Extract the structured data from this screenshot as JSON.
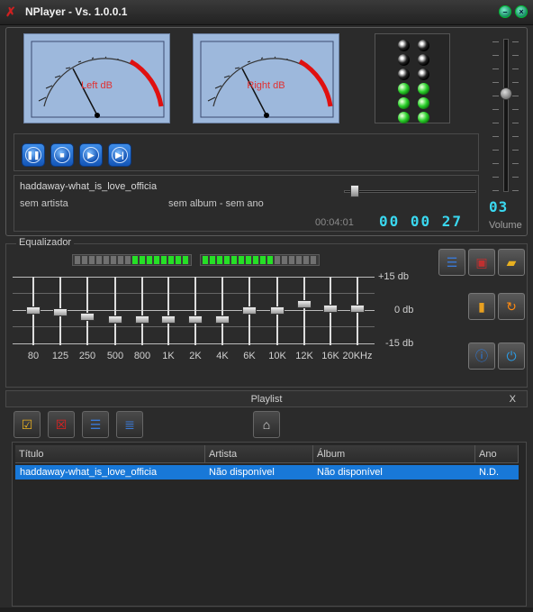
{
  "window": {
    "title": "NPlayer - Vs.  1.0.0.1",
    "minimize_icon": "minimize-icon",
    "close_icon": "close-icon"
  },
  "meters": {
    "left_label": "Left dB",
    "right_label": "Right dB"
  },
  "leds": {
    "left": [
      "off",
      "off",
      "off",
      "on",
      "on",
      "on"
    ],
    "right": [
      "off",
      "off",
      "off",
      "on",
      "on",
      "on"
    ]
  },
  "volume": {
    "digits": "03",
    "label": "Volume",
    "level": 0.64
  },
  "transport": {
    "buttons": [
      {
        "name": "pause-button",
        "icon": "pause-icon"
      },
      {
        "name": "stop-button",
        "icon": "stop-icon"
      },
      {
        "name": "play-button",
        "icon": "play-icon"
      },
      {
        "name": "next-button",
        "icon": "next-track-icon"
      }
    ]
  },
  "track": {
    "title": "haddaway-what_is_love_officia",
    "artist": "sem artista",
    "album_year": "sem album - sem ano",
    "total_time": "00:04:01",
    "elapsed": "00 00 27",
    "progress": 0.08
  },
  "equalizer": {
    "legend": "Equalizador",
    "db_labels": {
      "top": "+15 db",
      "mid": "0 db",
      "bottom": "-15 db"
    },
    "bands": [
      {
        "label": "80",
        "gain_db": 0
      },
      {
        "label": "125",
        "gain_db": -1
      },
      {
        "label": "250",
        "gain_db": -3
      },
      {
        "label": "500",
        "gain_db": -4
      },
      {
        "label": "800",
        "gain_db": -4
      },
      {
        "label": "1K",
        "gain_db": -4
      },
      {
        "label": "2K",
        "gain_db": -4
      },
      {
        "label": "4K",
        "gain_db": -4
      },
      {
        "label": "6K",
        "gain_db": 0
      },
      {
        "label": "10K",
        "gain_db": 0
      },
      {
        "label": "12K",
        "gain_db": 3
      },
      {
        "label": "16K",
        "gain_db": 1
      },
      {
        "label": "20KHz",
        "gain_db": 1
      }
    ],
    "side_buttons": [
      {
        "name": "playlist-edit-button",
        "icon": "list-edit-icon"
      },
      {
        "name": "save-button",
        "icon": "floppy-save-icon"
      },
      {
        "name": "open-folder-button",
        "icon": "folder-open-icon"
      },
      {
        "name": "equalizer-toggle-button",
        "icon": "bar-chart-icon"
      },
      {
        "name": "refresh-button",
        "icon": "refresh-icon"
      },
      {
        "name": "info-button",
        "icon": "info-icon"
      },
      {
        "name": "power-button",
        "icon": "power-icon"
      }
    ]
  },
  "playlist": {
    "title": "Playlist",
    "close_label": "X",
    "tools": [
      {
        "name": "add-files-button",
        "icon": "add-checklist-icon"
      },
      {
        "name": "remove-files-button",
        "icon": "remove-x-icon"
      },
      {
        "name": "edit-list-button",
        "icon": "list-edit-icon"
      },
      {
        "name": "list-view-button",
        "icon": "list-view-icon"
      },
      {
        "name": "tag-button",
        "icon": "tag-icon"
      }
    ],
    "columns": [
      "Título",
      "Artista",
      "Álbum",
      "Ano"
    ],
    "rows": [
      {
        "title": "haddaway-what_is_love_officia",
        "artist": "Não disponível",
        "album": "Não disponível",
        "year": "N.D."
      }
    ]
  }
}
